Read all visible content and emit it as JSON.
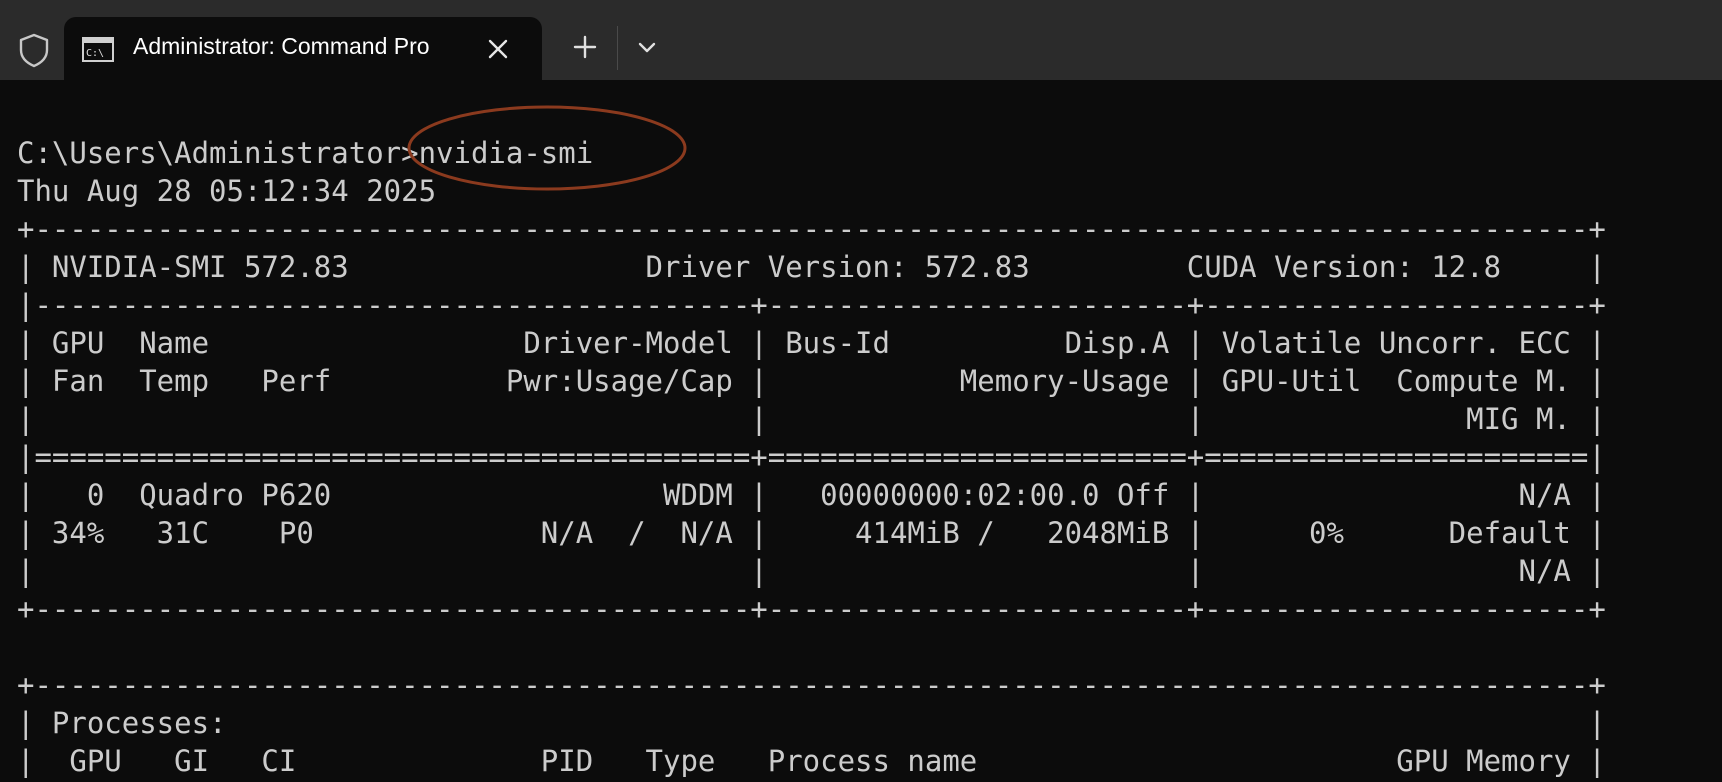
{
  "window": {
    "tab_title": "Administrator: Command Pro",
    "icons": {
      "shield": "shield-icon",
      "tab": "command-prompt-icon",
      "close": "close-icon",
      "new_tab": "plus-icon",
      "dropdown": "chevron-down-icon"
    }
  },
  "terminal": {
    "lines": [
      "C:\\Users\\Administrator>nvidia-smi",
      "Thu Aug 28 05:12:34 2025",
      "+-----------------------------------------------------------------------------------------+",
      "| NVIDIA-SMI 572.83                 Driver Version: 572.83         CUDA Version: 12.8     |",
      "|-----------------------------------------+------------------------+----------------------+",
      "| GPU  Name                  Driver-Model | Bus-Id          Disp.A | Volatile Uncorr. ECC |",
      "| Fan  Temp   Perf          Pwr:Usage/Cap |           Memory-Usage | GPU-Util  Compute M. |",
      "|                                         |                        |               MIG M. |",
      "|=========================================+========================+======================|",
      "|   0  Quadro P620                   WDDM |   00000000:02:00.0 Off |                  N/A |",
      "| 34%   31C    P0             N/A  /  N/A |     414MiB /   2048MiB |      0%      Default |",
      "|                                         |                        |                  N/A |",
      "+-----------------------------------------+------------------------+----------------------+",
      "",
      "+-----------------------------------------------------------------------------------------+",
      "| Processes:                                                                              |",
      "|  GPU   GI   CI              PID   Type   Process name                        GPU Memory |"
    ]
  },
  "colors": {
    "terminal_bg": "#0c0c0c",
    "titlebar_bg": "#2b2b2b",
    "text": "#cccccc",
    "annotation": "#8b3a1e"
  }
}
